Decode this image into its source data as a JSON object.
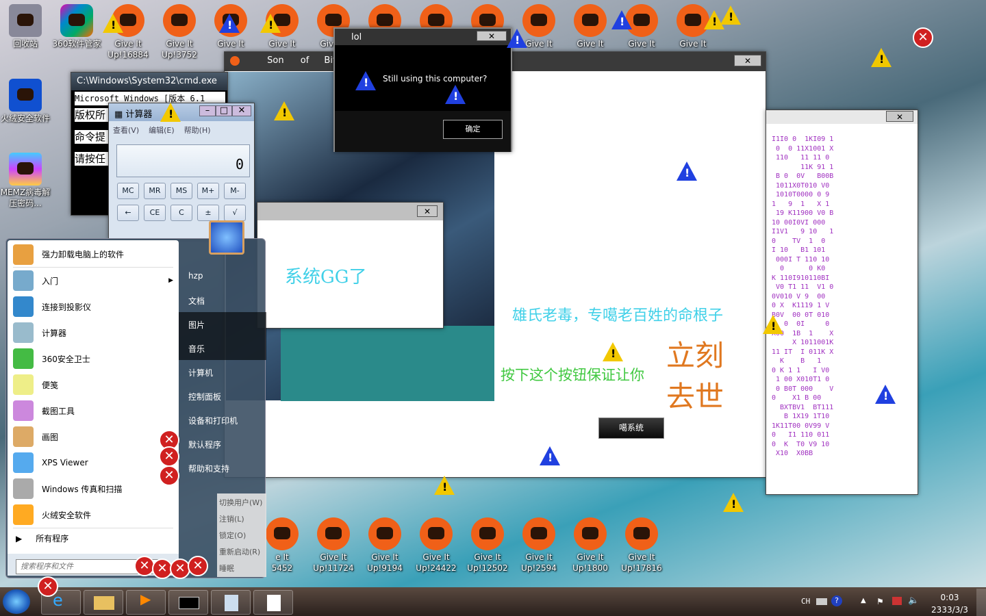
{
  "desktop": {
    "top_icons": [
      {
        "label": "回收站"
      },
      {
        "label": "360软件管家"
      },
      {
        "label": "Give It Up!16884"
      },
      {
        "label": "Give It Up!3752"
      },
      {
        "label": "Give It"
      },
      {
        "label": "Give It"
      },
      {
        "label": "Give It"
      },
      {
        "label": "Give It"
      },
      {
        "label": "Give It"
      },
      {
        "label": "Give It"
      },
      {
        "label": "Give It"
      },
      {
        "label": "Give It"
      },
      {
        "label": "Give It"
      },
      {
        "label": "Give It"
      }
    ],
    "left_icons": [
      {
        "label": "火绒安全软件"
      },
      {
        "label": "MEMZ病毒解压密码..."
      }
    ],
    "bottom_icons": [
      {
        "label": "e It 5452"
      },
      {
        "label": "Give It Up!11724"
      },
      {
        "label": "Give It Up!9194"
      },
      {
        "label": "Give It Up!24422"
      },
      {
        "label": "Give It Up!12502"
      },
      {
        "label": "Give It Up!2594"
      },
      {
        "label": "Give It Up!1800"
      },
      {
        "label": "Give It Up!17816"
      }
    ]
  },
  "cmd": {
    "title": "C:\\Windows\\System32\\cmd.exe",
    "lines": [
      "Microsoft Windows [版本 6.1",
      "版权所",
      "命令提",
      "请按任"
    ]
  },
  "calculator": {
    "title": "计算器",
    "menu": [
      "查看(V)",
      "编辑(E)",
      "帮助(H)"
    ],
    "display": "0",
    "buttons": [
      "MC",
      "MR",
      "MS",
      "M+",
      "M-",
      "←",
      "CE",
      "C",
      "±",
      "√"
    ]
  },
  "lol_dialog": {
    "title": "lol",
    "message": "Still using this computer?",
    "ok": "确定"
  },
  "main_window": {
    "title_words": [
      "Son",
      "of",
      "Bit"
    ],
    "line1": "雄氏老毒，专噶老百姓的命根子",
    "line2": "按下这个按钮保证让你",
    "big": [
      "立刻",
      "去世"
    ],
    "button": "噶系统"
  },
  "small_window": {
    "text": "系统GG了"
  },
  "start_menu": {
    "pinned": [
      {
        "label": "强力卸载电脑上的软件"
      },
      {
        "label": "入门"
      },
      {
        "label": "连接到投影仪"
      },
      {
        "label": "计算器"
      },
      {
        "label": "360安全卫士"
      },
      {
        "label": "便笺"
      },
      {
        "label": "截图工具"
      },
      {
        "label": "画图"
      },
      {
        "label": "XPS Viewer"
      },
      {
        "label": "Windows 传真和扫描"
      },
      {
        "label": "火绒安全软件"
      }
    ],
    "all_programs": "所有程序",
    "search_placeholder": "搜索程序和文件",
    "right": [
      {
        "label": "hzp"
      },
      {
        "label": "文档"
      },
      {
        "label": "图片"
      },
      {
        "label": "音乐"
      },
      {
        "label": "计算机"
      },
      {
        "label": "控制面板"
      },
      {
        "label": "设备和打印机"
      },
      {
        "label": "默认程序"
      },
      {
        "label": "帮助和支持"
      }
    ],
    "shutdown_menu": [
      "切换用户(W)",
      "注销(L)",
      "锁定(O)",
      "重新启动(R)",
      "睡眠"
    ]
  },
  "taskbar": {
    "lang": "CH",
    "time": "0:03",
    "date": "2333/3/3"
  },
  "colors": {
    "cyan_text": "#40d0e8",
    "green_text": "#40c840",
    "orange_text": "#e07820",
    "icon_orange": "#f06018"
  }
}
